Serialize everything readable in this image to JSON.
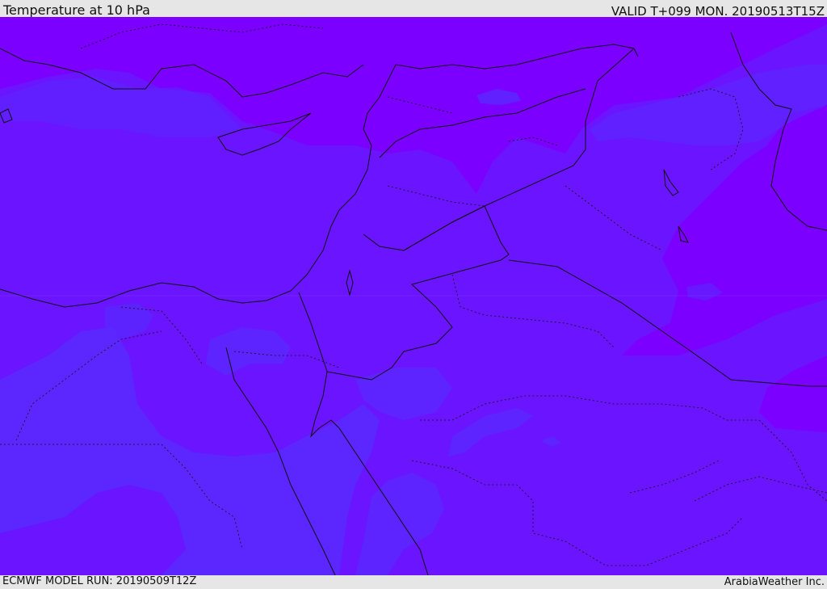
{
  "header": {
    "title": "Temperature at 10 hPa",
    "valid": "VALID T+099 MON. 20190513T15Z"
  },
  "footer": {
    "model_run": "ECMWF MODEL RUN: 20190509T12Z",
    "credit": "ArabiaWeather Inc."
  },
  "map": {
    "region": "Eastern Mediterranean / Middle East",
    "colors": {
      "warmer_band": "#7b00ff",
      "mid_band": "#6a14ff",
      "cooler_band": "#5a28ff",
      "coastline": "#111111",
      "border": "#111111"
    }
  }
}
